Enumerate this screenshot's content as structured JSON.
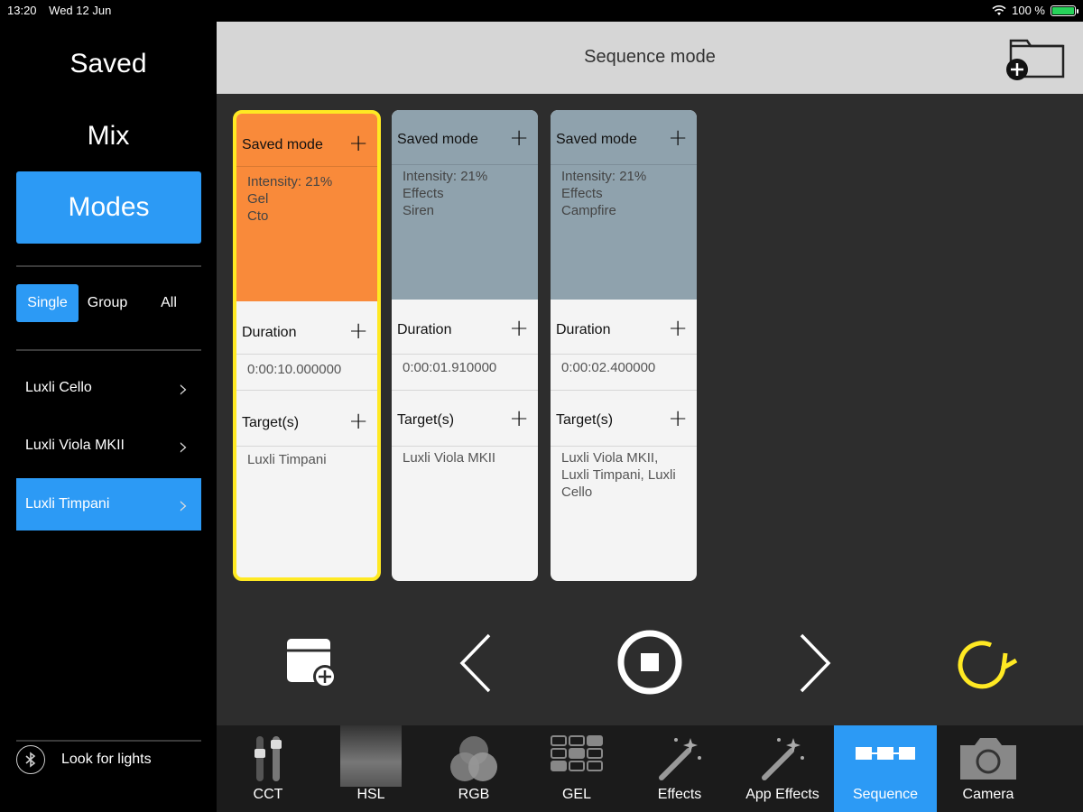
{
  "status": {
    "time": "13:20",
    "date": "Wed 12 Jun",
    "battery": "100 %"
  },
  "sidebar": {
    "saved_label": "Saved",
    "mix_label": "Mix",
    "modes_label": "Modes",
    "segment": [
      "Single",
      "Group",
      "All"
    ],
    "lights": [
      {
        "name": "Luxli Cello",
        "active": false
      },
      {
        "name": "Luxli Viola MKII",
        "active": false
      },
      {
        "name": "Luxli Timpani",
        "active": true
      }
    ],
    "look_label": "Look for lights"
  },
  "header": {
    "title": "Sequence mode"
  },
  "cards": [
    {
      "mode_title": "Saved mode",
      "details": [
        "Intensity: 21%",
        "Gel",
        "Cto"
      ],
      "top_color": "#f98a3a",
      "duration_title": "Duration",
      "duration": "0:00:10.000000",
      "targets_title": "Target(s)",
      "targets": [
        "Luxli Timpani"
      ]
    },
    {
      "mode_title": "Saved mode",
      "details": [
        "Intensity: 21%",
        "Effects",
        "Siren"
      ],
      "top_color": "#8fa2ad",
      "duration_title": "Duration",
      "duration": "0:00:01.910000",
      "targets_title": "Target(s)",
      "targets": [
        "Luxli Viola MKII"
      ]
    },
    {
      "mode_title": "Saved mode",
      "details": [
        "Intensity: 21%",
        "Effects",
        "Campfire"
      ],
      "top_color": "#8fa2ad",
      "duration_title": "Duration",
      "duration": "0:00:02.400000",
      "targets_title": "Target(s)",
      "targets": [
        "Luxli Viola MKII,",
        "Luxli Timpani, Luxli",
        "Cello"
      ]
    }
  ],
  "tabs": [
    {
      "label": "CCT",
      "icon": "cct-sliders-icon"
    },
    {
      "label": "HSL",
      "icon": "hsl-gradient-icon"
    },
    {
      "label": "RGB",
      "icon": "rgb-circles-icon"
    },
    {
      "label": "GEL",
      "icon": "gel-grid-icon"
    },
    {
      "label": "Effects",
      "icon": "magic-wand-icon"
    },
    {
      "label": "App Effects",
      "icon": "magic-wand-icon"
    },
    {
      "label": "Sequence",
      "icon": "sequence-icon"
    },
    {
      "label": "Camera",
      "icon": "camera-icon"
    }
  ],
  "colors": {
    "accent": "#2c9af5",
    "selected_border": "#ffe923",
    "loop_icon": "#ffe923"
  }
}
